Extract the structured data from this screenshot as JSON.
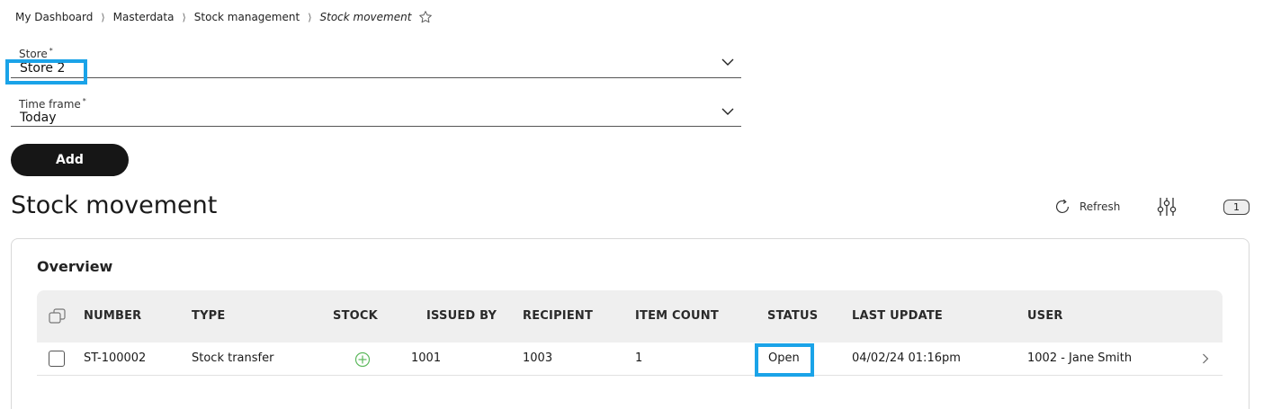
{
  "breadcrumb": {
    "items": [
      "My Dashboard",
      "Masterdata",
      "Stock management"
    ],
    "separator": "⟩",
    "current": "Stock movement"
  },
  "form": {
    "store": {
      "label": "Store",
      "required_mark": "*",
      "value": "Store 2"
    },
    "timeframe": {
      "label": "Time frame",
      "required_mark": "*",
      "value": "Today"
    },
    "add_label": "Add"
  },
  "page": {
    "title": "Stock movement",
    "refresh_label": "Refresh",
    "filter_count": "1"
  },
  "overview": {
    "title": "Overview",
    "columns": [
      "NUMBER",
      "TYPE",
      "STOCK",
      "ISSUED BY",
      "RECIPIENT",
      "ITEM COUNT",
      "STATUS",
      "LAST UPDATE",
      "USER"
    ],
    "rows": [
      {
        "number": "ST-100002",
        "type": "Stock transfer",
        "stock_icon": "plus-circle-icon",
        "issued_by": "1001",
        "recipient": "1003",
        "item_count": "1",
        "status": "Open",
        "last_update": "04/02/24 01:16pm",
        "user": "1002 - Jane Smith"
      }
    ]
  },
  "colors": {
    "accent_highlight": "#1aa3e8",
    "stock_icon": "#5cb85c",
    "button_bg": "#161616",
    "header_bg": "#efefef"
  }
}
